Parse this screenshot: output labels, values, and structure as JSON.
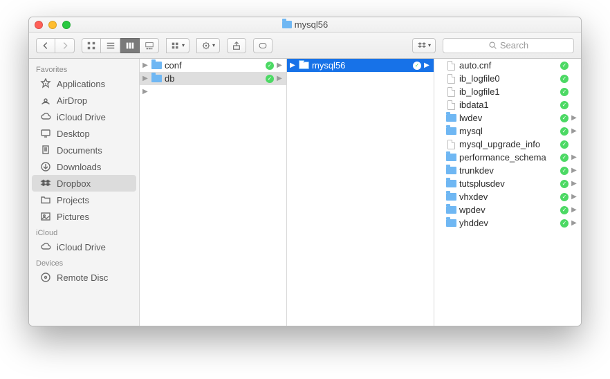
{
  "window": {
    "title": "mysql56"
  },
  "toolbar": {
    "search_placeholder": "Search"
  },
  "sidebar": {
    "sections": [
      {
        "label": "Favorites",
        "items": [
          {
            "icon": "apps",
            "label": "Applications"
          },
          {
            "icon": "airdrop",
            "label": "AirDrop"
          },
          {
            "icon": "cloud",
            "label": "iCloud Drive"
          },
          {
            "icon": "desktop",
            "label": "Desktop"
          },
          {
            "icon": "documents",
            "label": "Documents"
          },
          {
            "icon": "downloads",
            "label": "Downloads"
          },
          {
            "icon": "dropbox",
            "label": "Dropbox",
            "selected": true
          },
          {
            "icon": "folder",
            "label": "Projects"
          },
          {
            "icon": "pictures",
            "label": "Pictures"
          }
        ]
      },
      {
        "label": "iCloud",
        "items": [
          {
            "icon": "cloud",
            "label": "iCloud Drive"
          }
        ]
      },
      {
        "label": "Devices",
        "items": [
          {
            "icon": "disc",
            "label": "Remote Disc"
          }
        ]
      }
    ]
  },
  "columns": [
    {
      "items": [
        {
          "type": "folder",
          "label": "conf",
          "synced": true,
          "has_children": true
        },
        {
          "type": "folder",
          "label": "db",
          "synced": true,
          "has_children": true,
          "selected": true
        }
      ],
      "lonely_arrow": true
    },
    {
      "items": [
        {
          "type": "folder-hl",
          "label": "mysql56",
          "synced": true,
          "has_children": true,
          "highlighted": true
        }
      ]
    },
    {
      "items": [
        {
          "type": "file",
          "label": "auto.cnf",
          "synced": true
        },
        {
          "type": "file",
          "label": "ib_logfile0",
          "synced": true
        },
        {
          "type": "file",
          "label": "ib_logfile1",
          "synced": true
        },
        {
          "type": "file",
          "label": "ibdata1",
          "synced": true
        },
        {
          "type": "folder",
          "label": "lwdev",
          "synced": true,
          "has_children": true
        },
        {
          "type": "folder",
          "label": "mysql",
          "synced": true,
          "has_children": true
        },
        {
          "type": "file",
          "label": "mysql_upgrade_info",
          "synced": true
        },
        {
          "type": "folder",
          "label": "performance_schema",
          "synced": true,
          "has_children": true
        },
        {
          "type": "folder",
          "label": "trunkdev",
          "synced": true,
          "has_children": true
        },
        {
          "type": "folder",
          "label": "tutsplusdev",
          "synced": true,
          "has_children": true
        },
        {
          "type": "folder",
          "label": "vhxdev",
          "synced": true,
          "has_children": true
        },
        {
          "type": "folder",
          "label": "wpdev",
          "synced": true,
          "has_children": true
        },
        {
          "type": "folder",
          "label": "yhddev",
          "synced": true,
          "has_children": true
        }
      ]
    }
  ]
}
